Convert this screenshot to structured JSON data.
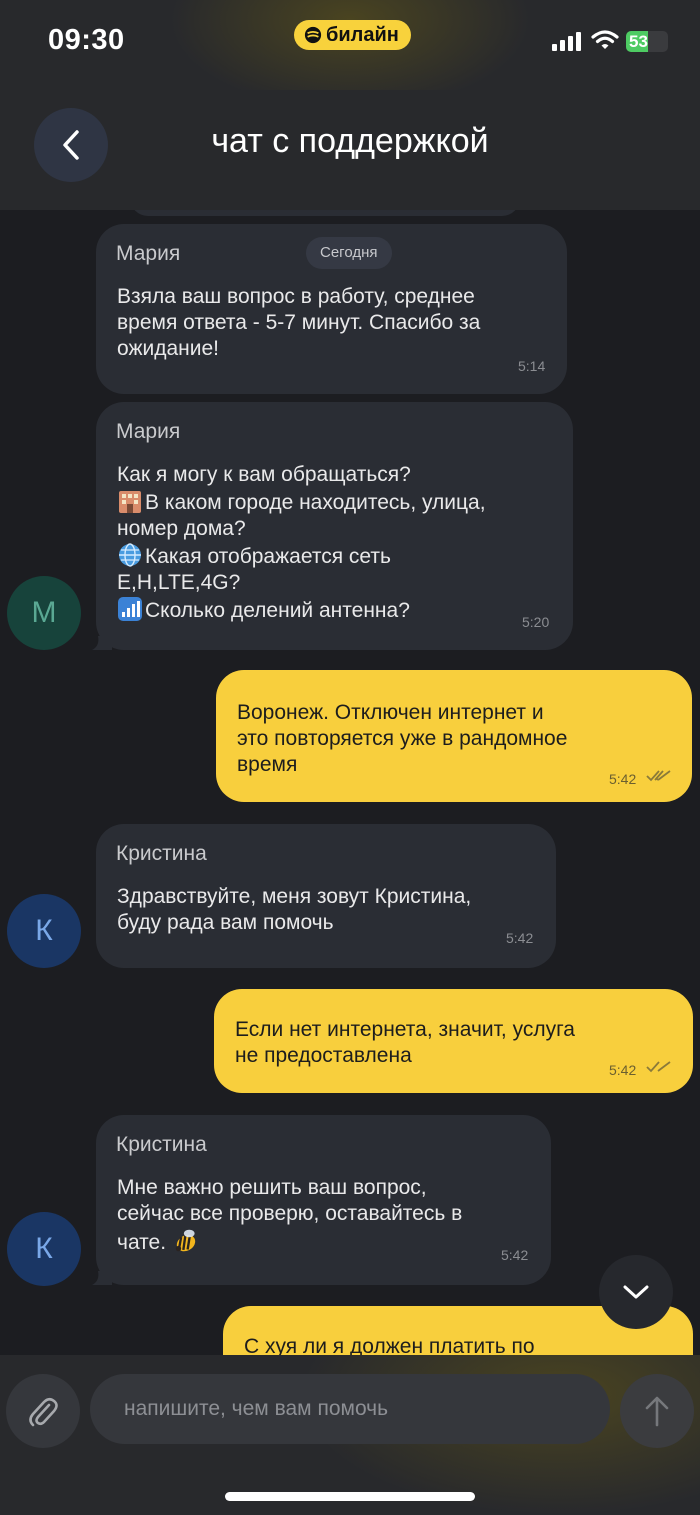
{
  "status_bar": {
    "time": "09:30",
    "carrier": "билайн",
    "battery": "53",
    "battery_level": 0.53,
    "signal_icon": "cellular-signal-icon",
    "wifi_icon": "wifi-icon"
  },
  "header": {
    "title": "чат с поддержкой",
    "back_icon": "chevron-left-icon"
  },
  "chat": {
    "date_chip": "Сегодня",
    "messages": [
      {
        "direction": "incoming",
        "sender": "Мария",
        "text": "Взяла ваш вопрос в работу, среднее\nвремя ответа - 5-7 минут. Спасибо за\nожидание!",
        "time": "5:14"
      },
      {
        "direction": "incoming",
        "sender": "Мария",
        "avatar": "М",
        "lines": [
          {
            "text": "Как я могу к вам обращаться?"
          },
          {
            "emoji": "hotel-emoji",
            "text": "В каком городе находитесь, улица,"
          },
          {
            "text": "номер дома?"
          },
          {
            "emoji": "globe-emoji",
            "text": "Какая отображается сеть"
          },
          {
            "text": "E,H,LTE,4G?"
          },
          {
            "emoji": "antenna-bars-emoji",
            "text": "Сколько делений антенна?"
          }
        ],
        "time": "5:20"
      },
      {
        "direction": "outgoing",
        "text": "Воронеж. Отключен интернет и\nэто повторяется уже в рандомное\nвремя",
        "time": "5:42",
        "status_icon": "double-check-icon"
      },
      {
        "direction": "incoming",
        "sender": "Кристина",
        "avatar": "К",
        "text": "Здравствуйте, меня зовут Кристина,\nбуду рада вам помочь",
        "time": "5:42"
      },
      {
        "direction": "outgoing",
        "text": "Если нет интернета, значит, услуга\nне предоставлена",
        "time": "5:42",
        "status_icon": "double-check-icon"
      },
      {
        "direction": "incoming",
        "sender": "Кристина",
        "avatar": "К",
        "text": "Мне важно решить ваш вопрос,\nсейчас все проверю, оставайтесь в\nчате.",
        "emoji": "bee-emoji",
        "time": "5:42"
      },
      {
        "direction": "outgoing",
        "text": "С хуя ли я должен платить по",
        "partial": true
      }
    ],
    "scroll_down_icon": "chevron-down-icon"
  },
  "composer": {
    "placeholder": "напишите, чем вам помочь",
    "attach_icon": "paperclip-icon",
    "send_icon": "arrow-up-icon"
  },
  "colors": {
    "background": "#1c1d21",
    "incoming_bubble": "#2a2d34",
    "outgoing_bubble": "#f8cf3d",
    "brand_yellow": "#f8d23c"
  }
}
